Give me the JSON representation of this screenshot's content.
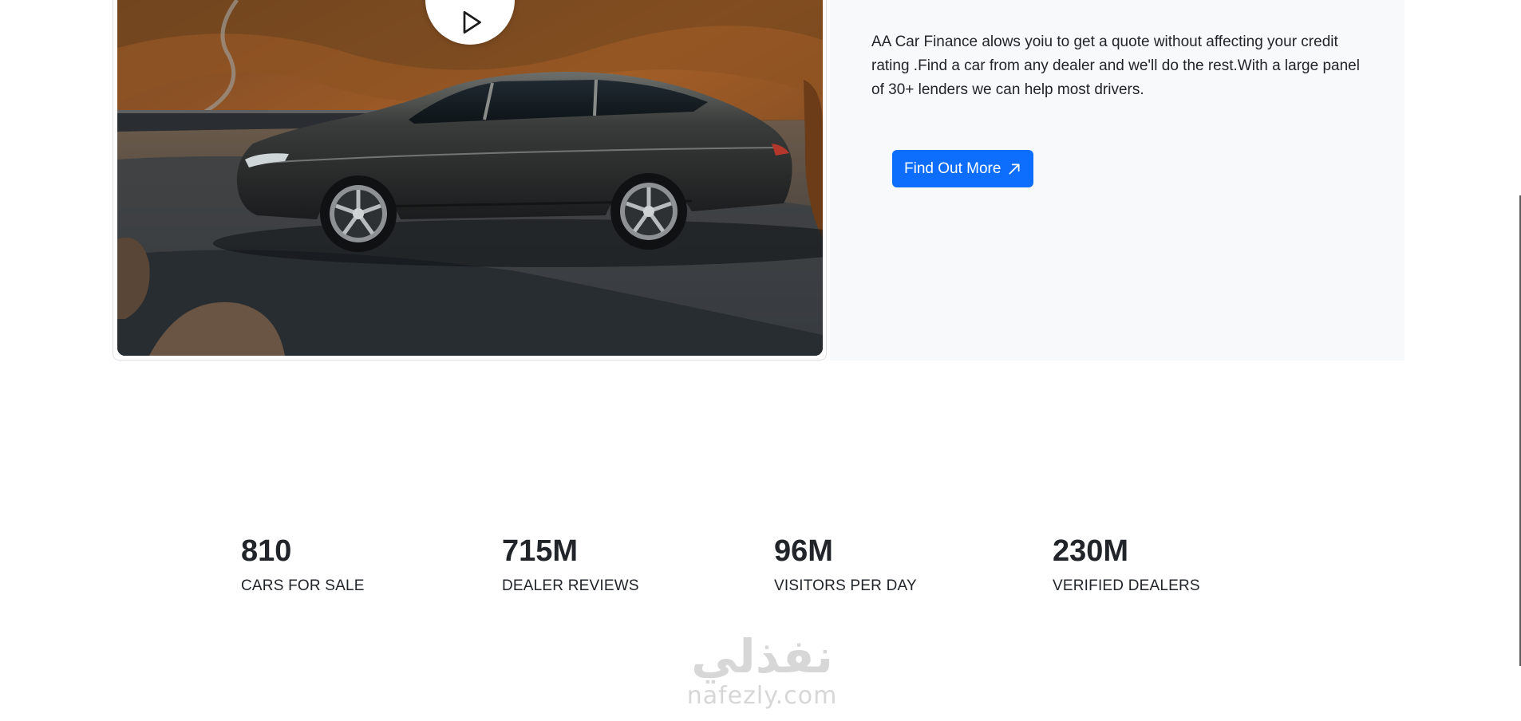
{
  "finance": {
    "description": "AA Car Finance alows yoiu to get a quote without affecting your credit rating .Find a car from any dealer and we'll do the rest.With a large panel of 30+ lenders we can help most drivers.",
    "button_label": "Find Out More"
  },
  "icons": {
    "play": "play-icon",
    "arrow": "arrow-up-right-icon"
  },
  "stats": [
    {
      "number": "810",
      "label": "CARS FOR SALE"
    },
    {
      "number": "715M",
      "label": "DEALER REVIEWS"
    },
    {
      "number": "96M",
      "label": "VISITORS PER DAY"
    },
    {
      "number": "230M",
      "label": "VERIFIED DEALERS"
    }
  ],
  "watermark": {
    "arabic": "نفذلي",
    "latin": "nafezly.com"
  },
  "colors": {
    "primary": "#0d6efd",
    "panel_bg": "#f8f9fa",
    "text": "#212529"
  }
}
